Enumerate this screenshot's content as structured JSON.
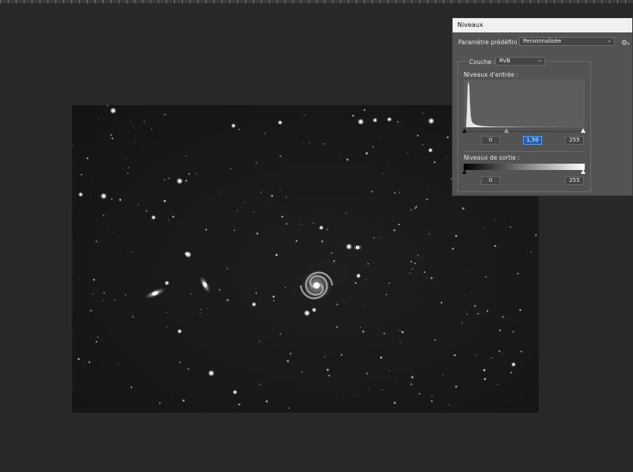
{
  "dialog": {
    "title": "Niveaux",
    "preset_label": "Paramètre prédéfini :",
    "preset_value": "Personnalisée",
    "channel_label": "Couche :",
    "channel_value": "RVB",
    "input_levels_label": "Niveaux d'entrée :",
    "output_levels_label": "Niveaux de sortie :",
    "input_black": "0",
    "input_gamma": "1,50",
    "input_white": "255",
    "output_black": "0",
    "output_white": "255",
    "icons": [
      "gear-icon",
      "chevron-down-icon",
      "slider-triangle-icon"
    ]
  },
  "colors": {
    "workspace": "#282828",
    "panel": "#535353",
    "titlebar": "#f1f1f1",
    "highlight": "#1c5fb8"
  }
}
